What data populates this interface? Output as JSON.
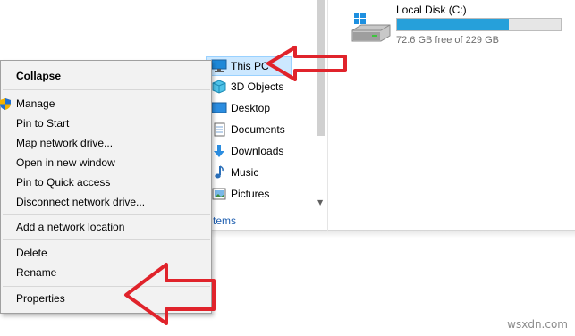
{
  "drive": {
    "name": "Local Disk (C:)",
    "free_text": "72.6 GB free of 229 GB",
    "used_fraction": 0.683,
    "bar_color": "#26a0da"
  },
  "nav": {
    "items": [
      {
        "label": "This PC",
        "icon": "computer-icon",
        "selected": true
      },
      {
        "label": "3D Objects",
        "icon": "cube-icon"
      },
      {
        "label": "Desktop",
        "icon": "desktop-folder-icon"
      },
      {
        "label": "Documents",
        "icon": "documents-icon"
      },
      {
        "label": "Downloads",
        "icon": "download-arrow-icon"
      },
      {
        "label": "Music",
        "icon": "music-note-icon"
      },
      {
        "label": "Pictures",
        "icon": "pictures-icon"
      }
    ],
    "status_partial": "tems"
  },
  "context_menu": {
    "collapse": "Collapse",
    "manage": "Manage",
    "pin_start": "Pin to Start",
    "map_drive": "Map network drive...",
    "open_window": "Open in new window",
    "pin_quick": "Pin to Quick access",
    "disconnect": "Disconnect network drive...",
    "add_location": "Add a network location",
    "delete": "Delete",
    "rename": "Rename",
    "properties": "Properties"
  },
  "colors": {
    "annotation_red": "#e0232b",
    "selection_bg": "#cce8ff",
    "link_blue": "#1f5fb0"
  },
  "watermark": "wsxdn.com"
}
